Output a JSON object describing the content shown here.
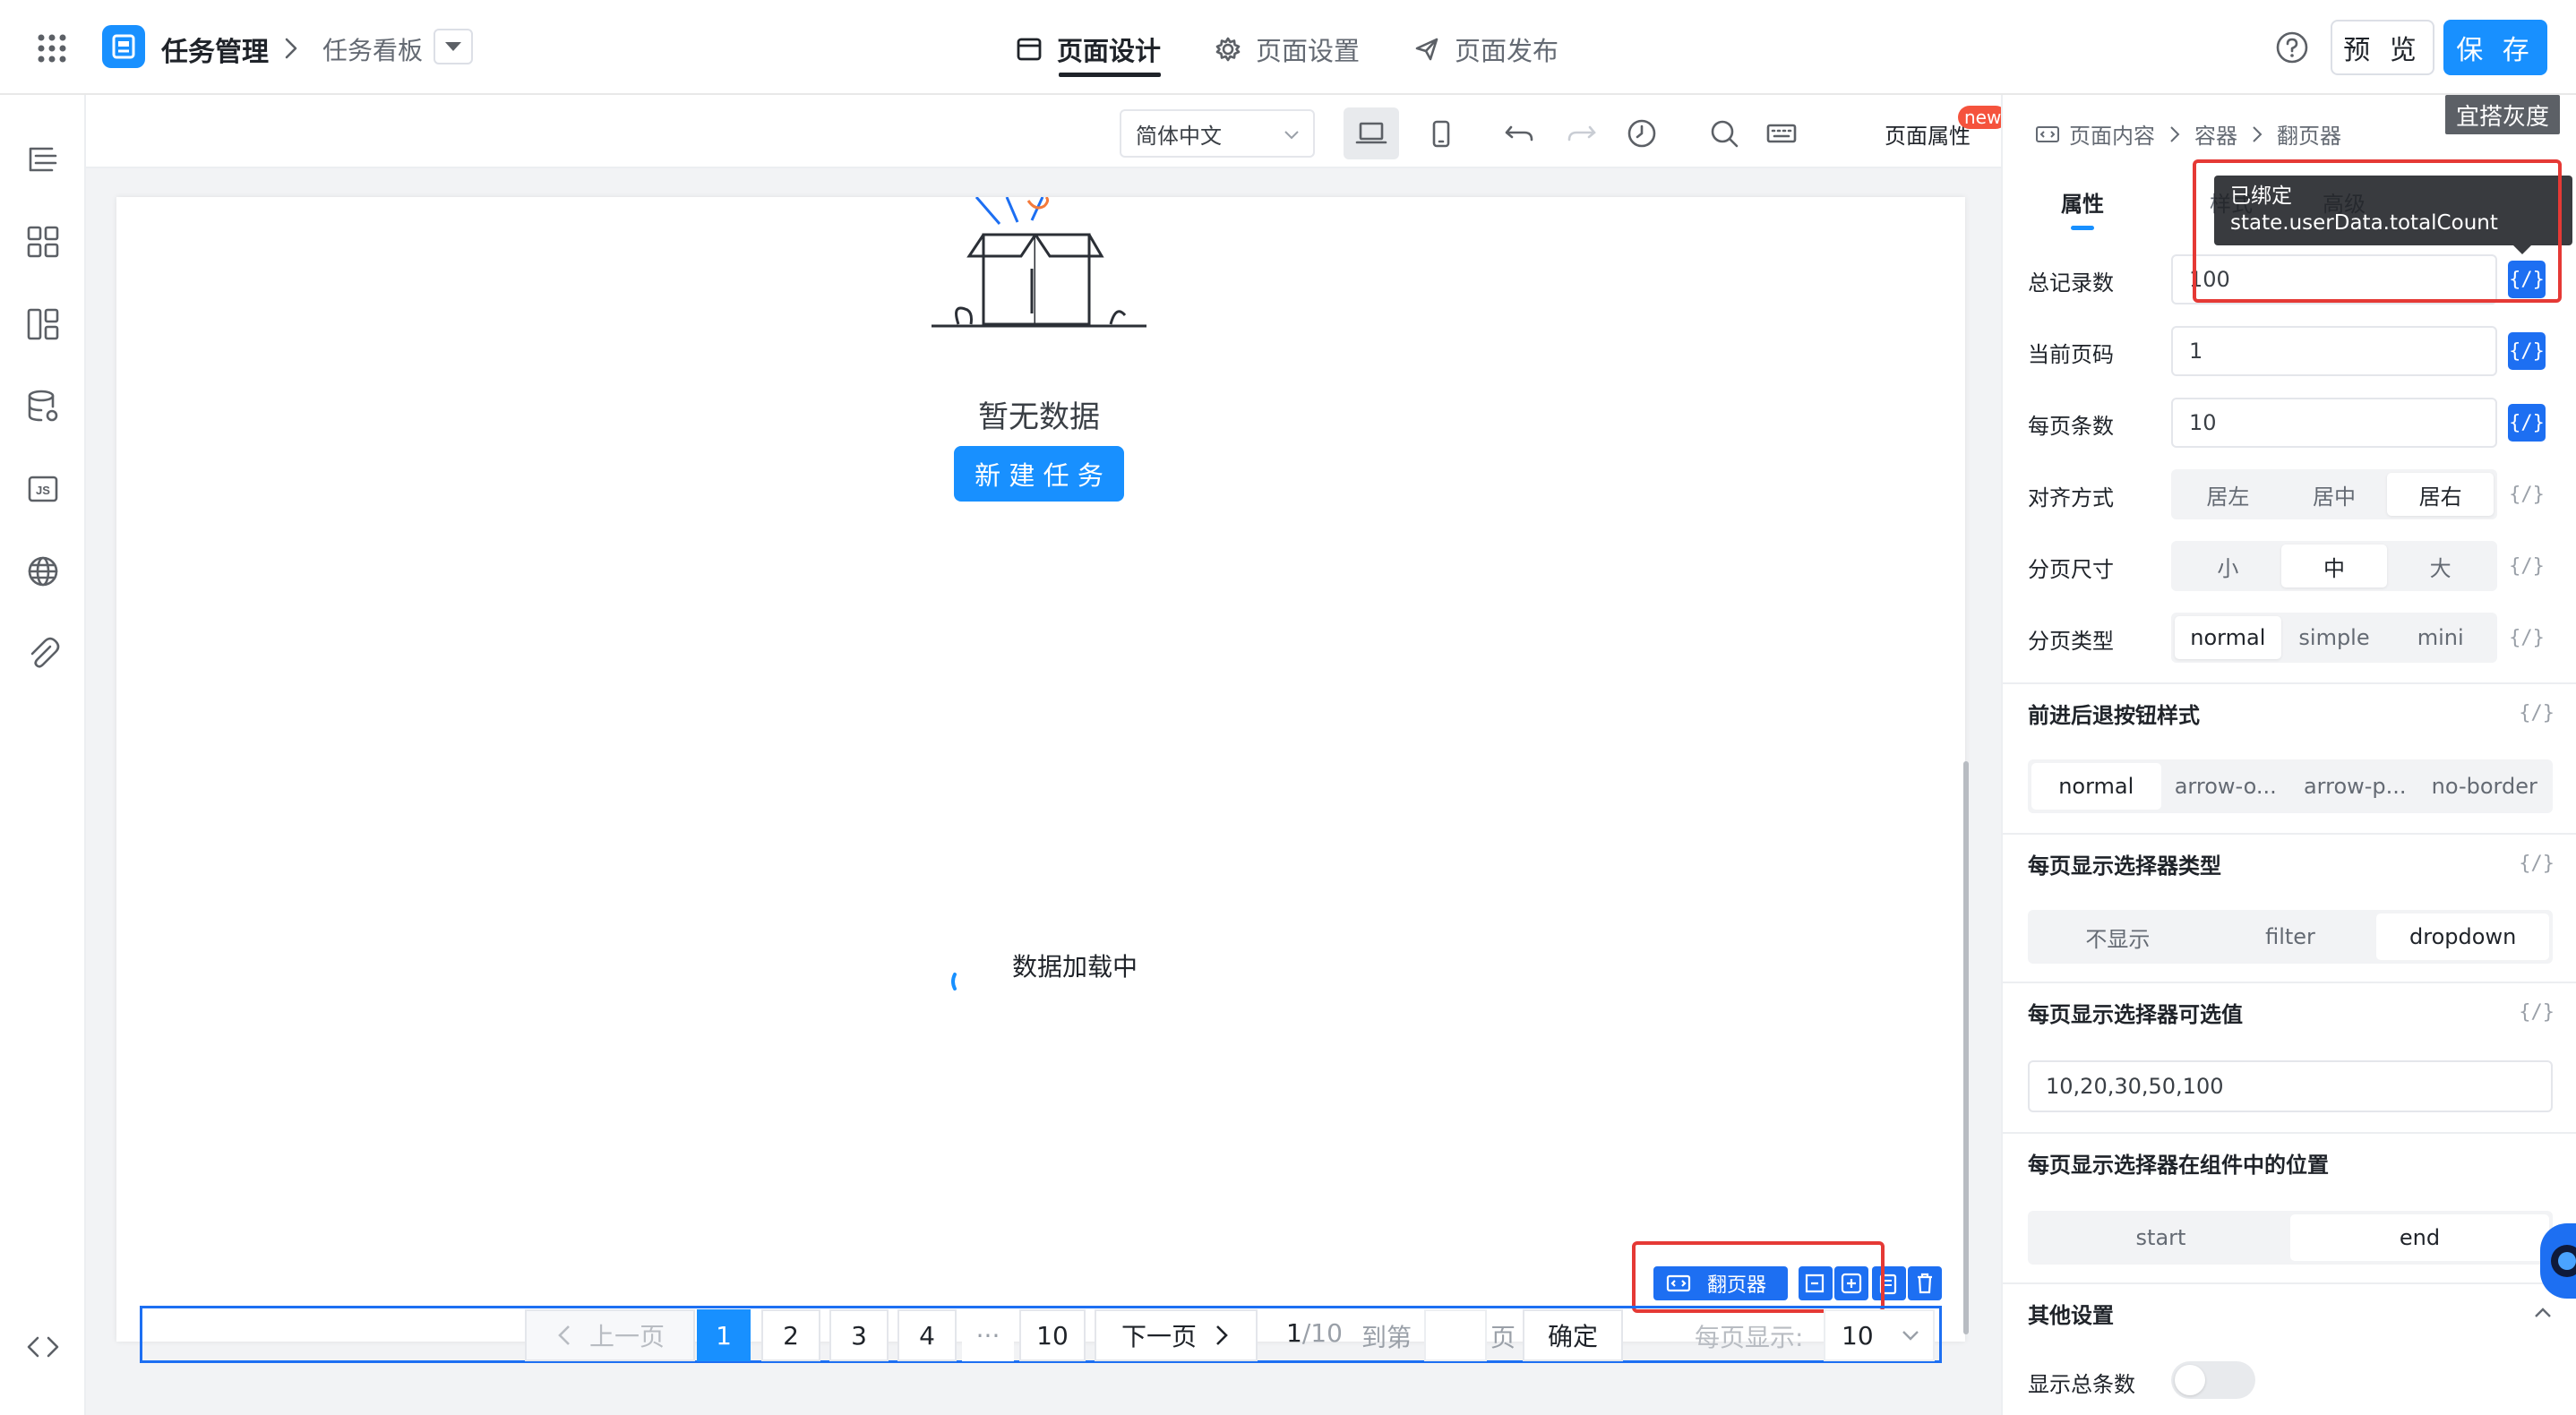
{
  "app": {
    "title": "任务管理",
    "page_name": "任务看板",
    "brand_color": "#1890ff"
  },
  "top_tabs": [
    {
      "label": "页面设计",
      "icon": "layout-icon",
      "active": true
    },
    {
      "label": "页面设置",
      "icon": "gear-icon",
      "active": false
    },
    {
      "label": "页面发布",
      "icon": "send-icon",
      "active": false
    }
  ],
  "top_actions": {
    "preview": "预 览",
    "save": "保 存"
  },
  "toolbar": {
    "language": "简体中文",
    "page_props": "页面属性",
    "new_badge": "new",
    "gray_badge": "宜搭灰度"
  },
  "breadcrumb": [
    "页面内容",
    "容器",
    "翻页器"
  ],
  "canvas": {
    "empty_text": "暂无数据",
    "new_task": "新 建 任 务",
    "loading": "数据加载中"
  },
  "component_tag": {
    "label": "翻页器"
  },
  "pagination": {
    "prev": "上一页",
    "pages": [
      "1",
      "2",
      "3",
      "4",
      "···",
      "10"
    ],
    "current": "1",
    "next": "下一页",
    "page_info_current": "1",
    "page_info_total": "/10",
    "goto_label": "到第",
    "page_unit": "页",
    "confirm": "确定",
    "page_size_label": "每页显示:",
    "page_size": "10"
  },
  "panel": {
    "tabs": [
      "属性",
      "样式",
      "高级"
    ],
    "active_tab": "属性",
    "tooltip_title": "已绑定",
    "tooltip_value": "state.userData.totalCount",
    "fields": [
      {
        "label": "总记录数",
        "value": "100",
        "bound": true
      },
      {
        "label": "当前页码",
        "value": "1",
        "bound": true
      },
      {
        "label": "每页条数",
        "value": "10",
        "bound": true
      }
    ],
    "align": {
      "label": "对齐方式",
      "options": [
        "居左",
        "居中",
        "居右"
      ],
      "selected": "居右"
    },
    "size": {
      "label": "分页尺寸",
      "options": [
        "小",
        "中",
        "大"
      ],
      "selected": "中"
    },
    "type": {
      "label": "分页类型",
      "options": [
        "normal",
        "simple",
        "mini"
      ],
      "selected": "normal"
    },
    "bind_symbol": "{/}",
    "btn_style": {
      "label": "前进后退按钮样式",
      "options": [
        "normal",
        "arrow-o...",
        "arrow-p...",
        "no-border"
      ],
      "selected": "normal"
    },
    "selector_type": {
      "label": "每页显示选择器类型",
      "options": [
        "不显示",
        "filter",
        "dropdown"
      ],
      "selected": "dropdown"
    },
    "selector_values": {
      "label": "每页显示选择器可选值",
      "value": "10,20,30,50,100"
    },
    "selector_pos": {
      "label": "每页显示选择器在组件中的位置",
      "options": [
        "start",
        "end"
      ],
      "selected": "end"
    },
    "other": {
      "label": "其他设置"
    },
    "show_total": {
      "label": "显示总条数",
      "on": false
    }
  }
}
